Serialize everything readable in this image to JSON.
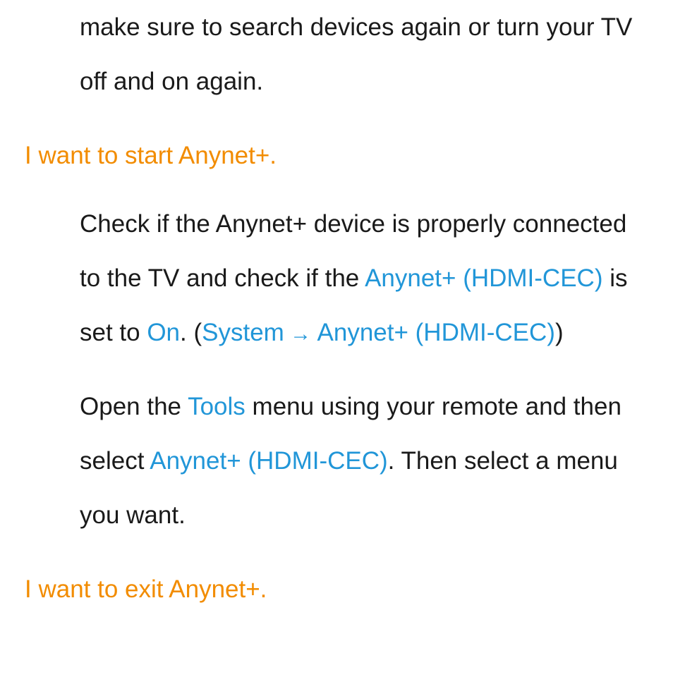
{
  "colors": {
    "heading": "#f28c00",
    "highlight": "#2196d8",
    "body": "#1a1a1a",
    "background": "#ffffff"
  },
  "para0": {
    "t1": "make sure to search devices again or turn your TV off and on again."
  },
  "heading1": "I want to start Anynet+.",
  "para1": {
    "t1": "Check if the Anynet+ device is properly connected to the TV and check if the ",
    "hl1": "Anynet+ (HDMI-CEC)",
    "t2": " is set to ",
    "hl2": "On",
    "t3": ". (",
    "hl3": "System",
    "arrow": " → ",
    "hl4": "Anynet+ (HDMI-CEC)",
    "t4": ")"
  },
  "para2": {
    "t1": "Open the ",
    "hl1": "Tools",
    "t2": " menu using your remote and then select ",
    "hl2": "Anynet+ (HDMI-CEC)",
    "t3": ". Then select a menu you want."
  },
  "heading2": "I want to exit Anynet+."
}
